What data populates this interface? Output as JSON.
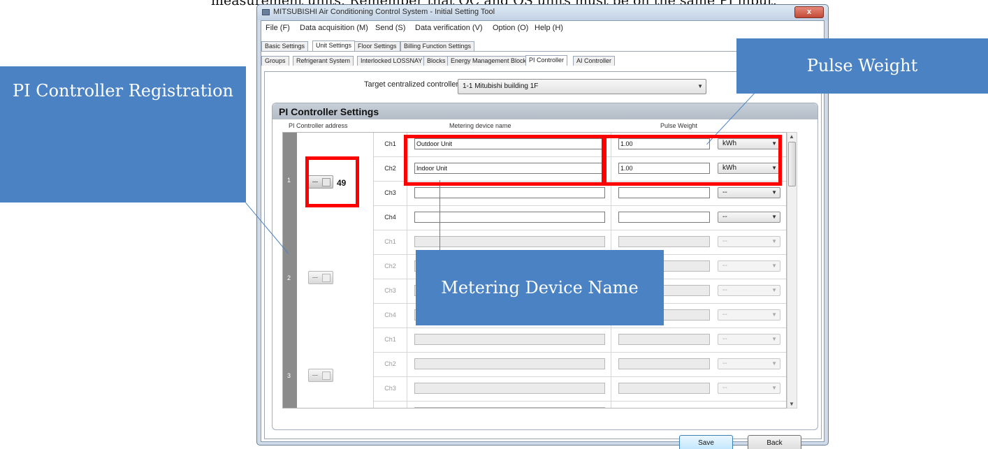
{
  "doc": {
    "top_line": "measurement units.  Remember that OC and OS units must be on the same PI input."
  },
  "window": {
    "title": "MITSUBISHI Air Conditioning Control System - Initial Setting Tool",
    "close_label": "x"
  },
  "menu": [
    "File (F)",
    "Data acquisition (M)",
    "Send (S)",
    "Data verification (V)",
    "Option (O)",
    "Help (H)"
  ],
  "main_tabs": [
    "Basic Settings",
    "Unit Settings",
    "Floor Settings",
    "Billing Function Settings"
  ],
  "sub_tabs": [
    "Groups",
    "Refrigerant System",
    "Interlocked LOSSNAY",
    "Blocks",
    "Energy Management Block",
    "PI Controller",
    "AI Controller"
  ],
  "target": {
    "label": "Target centralized controller:",
    "value": "1-1  Mitubishi building 1F"
  },
  "settings": {
    "title": "PI Controller Settings",
    "col_address": "PI Controller address",
    "col_name": "Metering device name",
    "col_pulse": "Pulse Weight"
  },
  "groups": [
    {
      "address": "1",
      "count": "49",
      "rows": [
        {
          "ch": "Ch1",
          "name": "Outdoor Unit",
          "pulse": "1.00",
          "unit": "kWh"
        },
        {
          "ch": "Ch2",
          "name": "Indoor Unit",
          "pulse": "1.00",
          "unit": "kWh"
        },
        {
          "ch": "Ch3",
          "name": "",
          "pulse": "",
          "unit": "--"
        },
        {
          "ch": "Ch4",
          "name": "",
          "pulse": "",
          "unit": "--"
        }
      ]
    },
    {
      "address": "2",
      "rows": [
        {
          "ch": "Ch1",
          "unit": "--"
        },
        {
          "ch": "Ch2",
          "unit": "--"
        },
        {
          "ch": "Ch3",
          "unit": "--"
        },
        {
          "ch": "Ch4",
          "unit": "--"
        }
      ]
    },
    {
      "address": "3",
      "rows": [
        {
          "ch": "Ch1",
          "unit": "--"
        },
        {
          "ch": "Ch2",
          "unit": "--"
        },
        {
          "ch": "Ch3",
          "unit": "--"
        }
      ]
    }
  ],
  "buttons": {
    "save": "Save",
    "back": "Back"
  },
  "annotations": {
    "pi_controller": "PI Controller Registration",
    "pulse_weight": "Pulse Weight",
    "metering": "Metering Device Name"
  },
  "colors": {
    "callout": "#4a82c4",
    "highlight": "#ff0000"
  }
}
